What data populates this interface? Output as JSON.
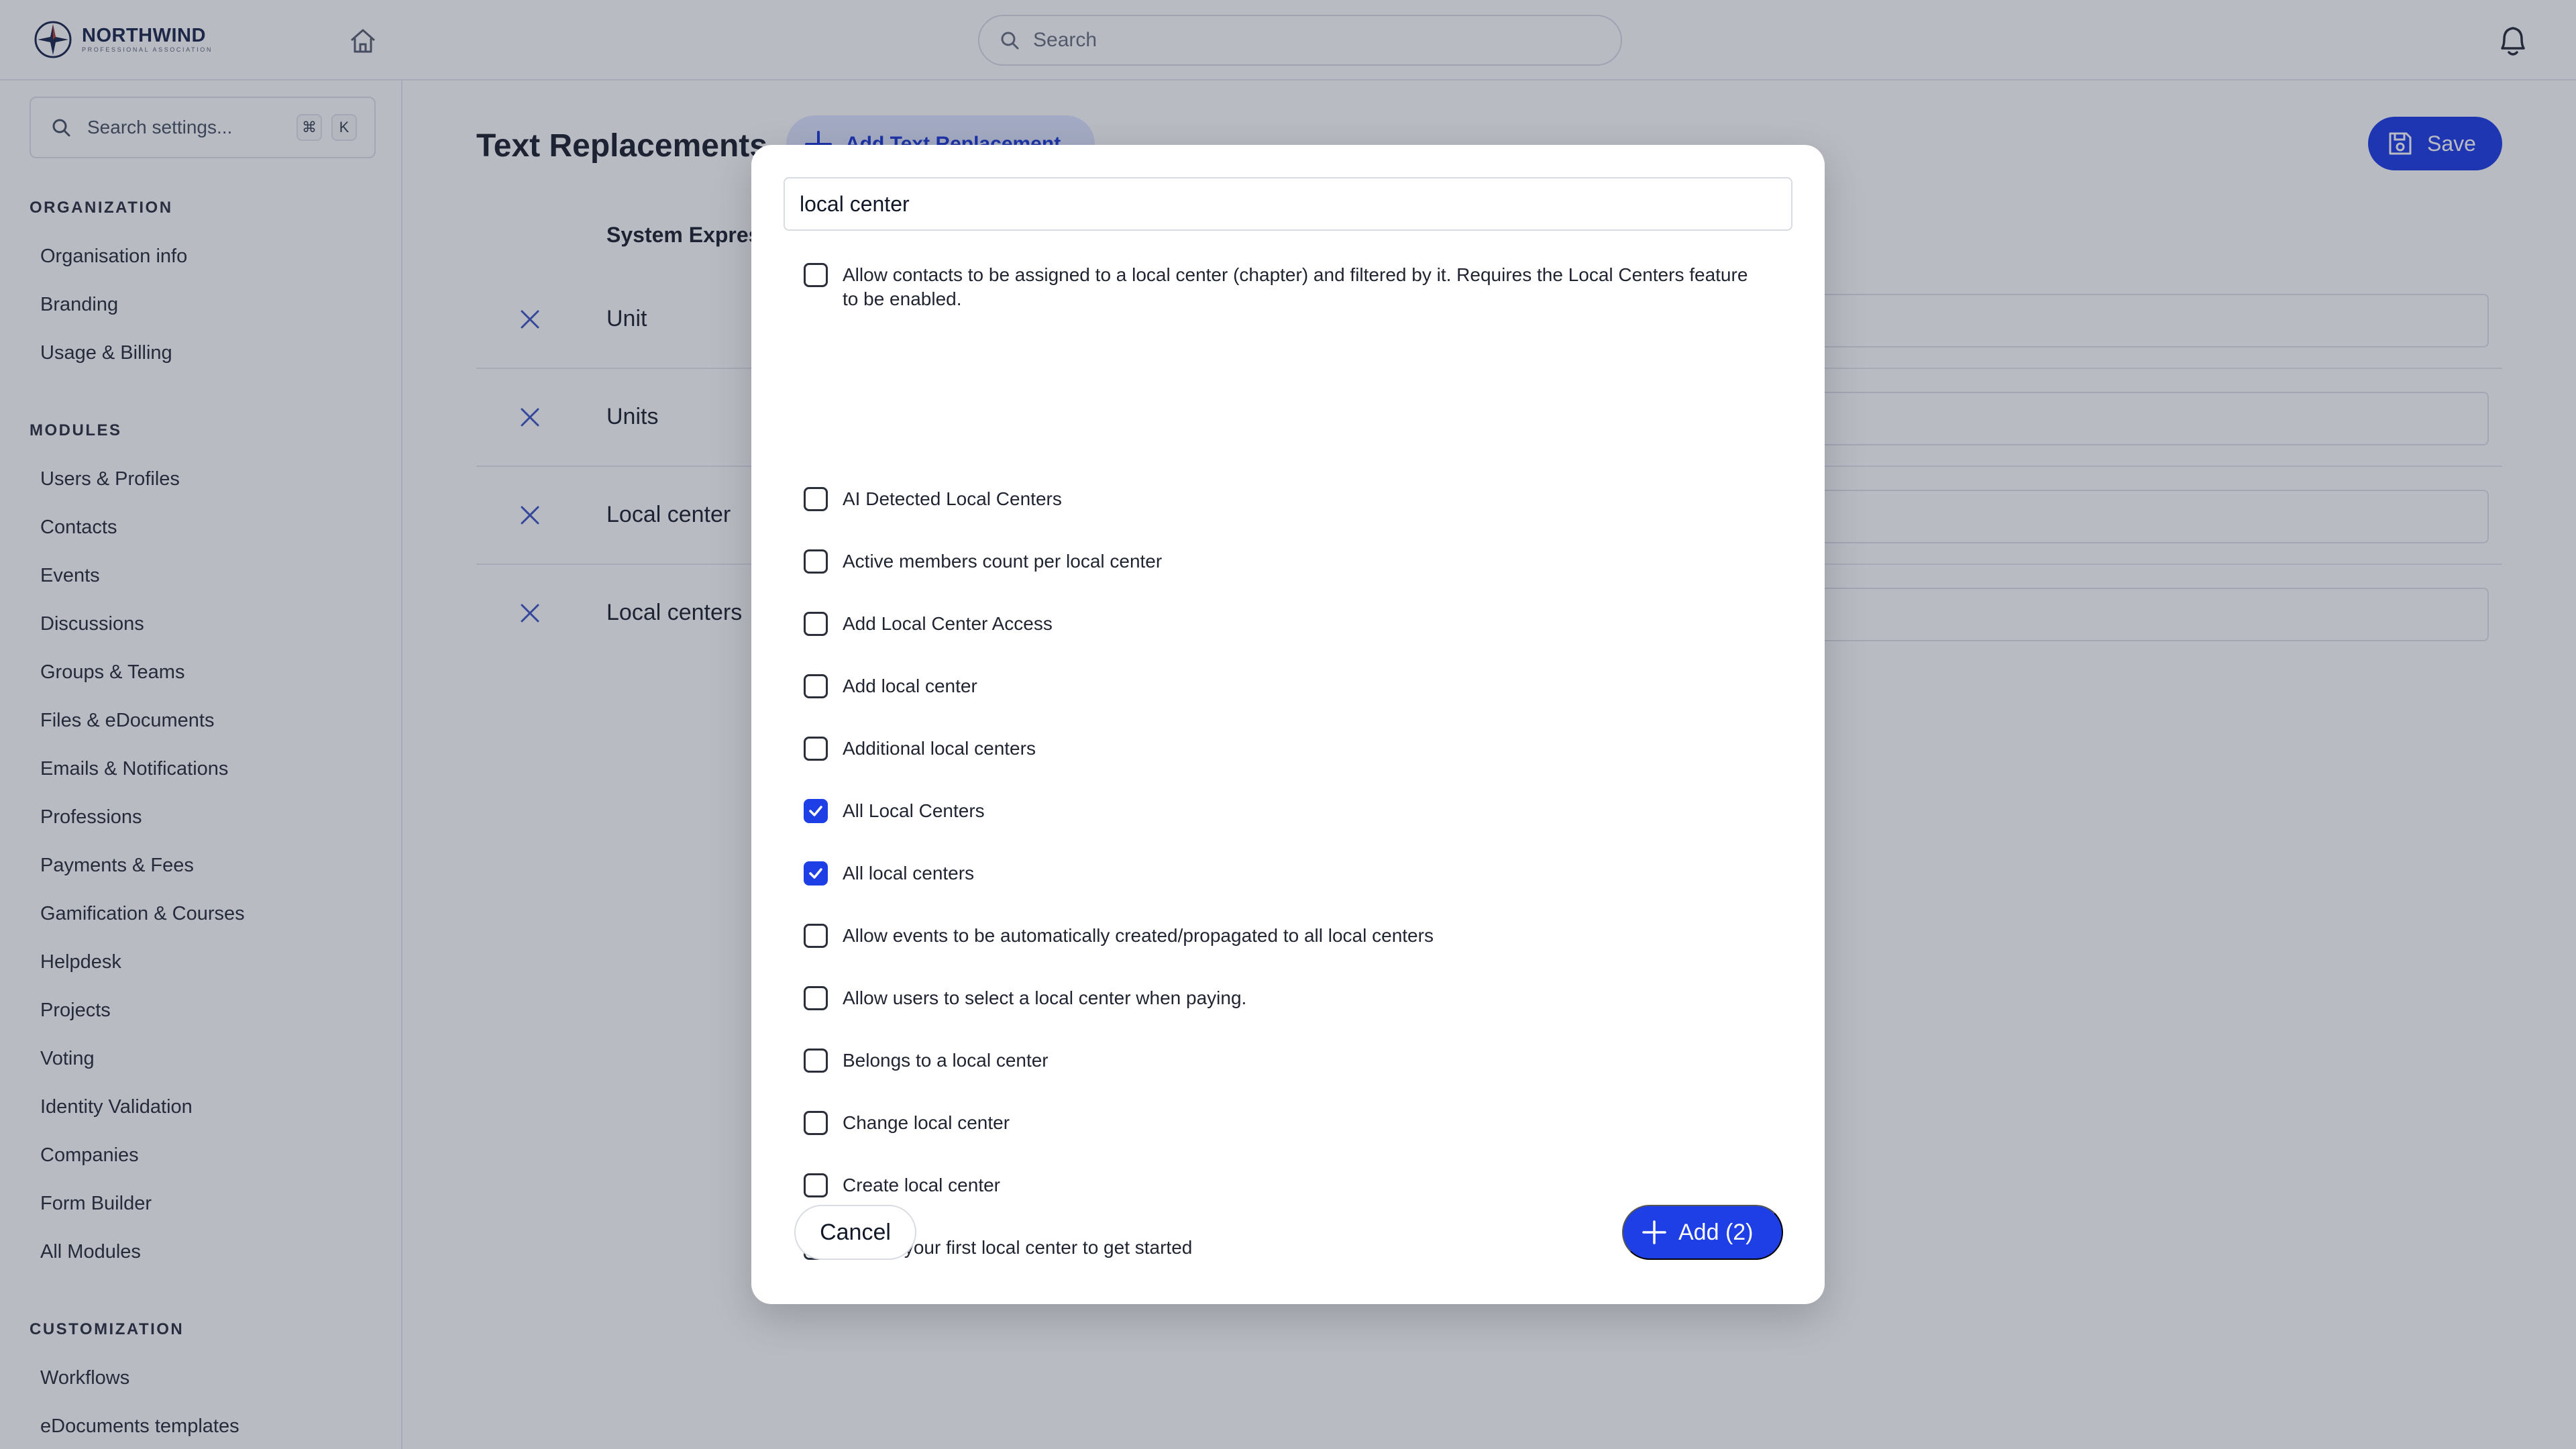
{
  "brand": {
    "name": "NORTHWIND",
    "tagline": "PROFESSIONAL ASSOCIATION"
  },
  "topbar": {
    "search_placeholder": "Search"
  },
  "sidebar": {
    "search_placeholder": "Search settings...",
    "shortcut_keys": [
      "⌘",
      "K"
    ],
    "sections": [
      {
        "title": "ORGANIZATION",
        "items": [
          "Organisation info",
          "Branding",
          "Usage & Billing"
        ]
      },
      {
        "title": "MODULES",
        "items": [
          "Users & Profiles",
          "Contacts",
          "Events",
          "Discussions",
          "Groups & Teams",
          "Files & eDocuments",
          "Emails & Notifications",
          "Professions",
          "Payments & Fees",
          "Gamification & Courses",
          "Helpdesk",
          "Projects",
          "Voting",
          "Identity Validation",
          "Companies",
          "Form Builder",
          "All Modules"
        ]
      },
      {
        "title": "CUSTOMIZATION",
        "items": [
          "Workflows",
          "eDocuments templates"
        ]
      }
    ]
  },
  "main": {
    "title": "Text Replacements",
    "add_button": "Add Text Replacement",
    "save_button": "Save",
    "column_header": "System Expressions",
    "rows": [
      "Unit",
      "Units",
      "Local center",
      "Local centers"
    ]
  },
  "modal": {
    "search_value": "local center",
    "options": [
      {
        "label": "Allow contacts to be assigned to a local center (chapter) and filtered by it. Requires the Local Centers feature to be enabled.",
        "checked": false
      },
      {
        "label": "AI Detected Local Centers",
        "checked": false
      },
      {
        "label": "Active members count per local center",
        "checked": false
      },
      {
        "label": "Add Local Center Access",
        "checked": false
      },
      {
        "label": "Add local center",
        "checked": false
      },
      {
        "label": "Additional local centers",
        "checked": false
      },
      {
        "label": "All Local Centers",
        "checked": true
      },
      {
        "label": "All local centers",
        "checked": true
      },
      {
        "label": "Allow events to be automatically created/propagated to all local centers",
        "checked": false
      },
      {
        "label": "Allow users to select a local center when paying.",
        "checked": false
      },
      {
        "label": "Belongs to a local center",
        "checked": false
      },
      {
        "label": "Change local center",
        "checked": false
      },
      {
        "label": "Create local center",
        "checked": false
      },
      {
        "label": "Create your first local center to get started",
        "checked": false
      }
    ],
    "cancel_label": "Cancel",
    "add_label": "Add (2)"
  },
  "colors": {
    "accent": "#1f3fe6",
    "accent_soft": "#dfe7ff",
    "overlay": "#1e253c"
  }
}
